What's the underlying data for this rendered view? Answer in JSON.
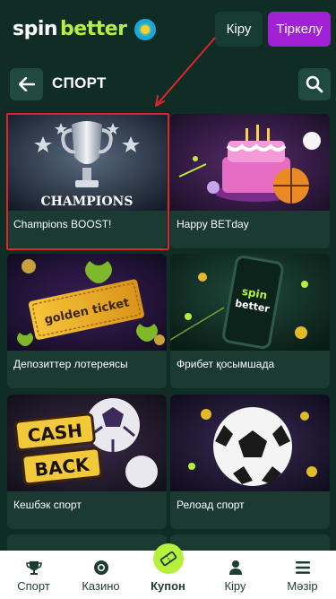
{
  "header": {
    "logo_spin": "spin",
    "logo_better": "better",
    "login_label": "Кіру",
    "register_label": "Тіркелу"
  },
  "section": {
    "title": "СПОРТ"
  },
  "cards": [
    {
      "label": "Champions BOOST!",
      "art_text": "CHAMPIONS"
    },
    {
      "label": "Happy BETday"
    },
    {
      "label": "Депозиттер лотереясы",
      "art_text": "golden ticket"
    },
    {
      "label": "Фрибет қосымшада",
      "art_text_1": "spin",
      "art_text_2": "better"
    },
    {
      "label": "Кешбэк спорт",
      "art_text_1": "CASH",
      "art_text_2": "BACK"
    },
    {
      "label": "Релоад спорт"
    }
  ],
  "bottom_nav": {
    "items": [
      {
        "label": "Спорт",
        "icon": "trophy-icon"
      },
      {
        "label": "Казино",
        "icon": "chip-icon"
      },
      {
        "label": "Купон",
        "icon": "ticket-icon"
      },
      {
        "label": "Кіру",
        "icon": "user-icon"
      },
      {
        "label": "Мәзір",
        "icon": "menu-icon"
      }
    ]
  },
  "colors": {
    "background": "#0f2c25",
    "card": "#1a3a32",
    "accent_green": "#b6f03b",
    "register_purple": "#a021d6",
    "highlight_red": "#e0242a"
  }
}
